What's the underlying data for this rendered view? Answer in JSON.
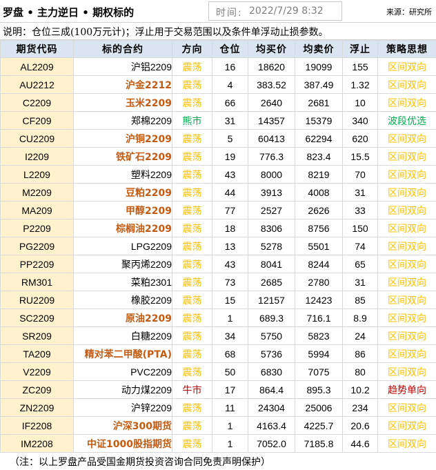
{
  "header": {
    "title": "罗盘 • 主力逆日 • 期权标的",
    "time_label": "时间:",
    "time_value": "2022/7/29 8:32",
    "source": "来源：研究所"
  },
  "note": "说明：仓位三成(100万元计)；浮止用于交易范围以及条件单浮动止损参数。",
  "columns": [
    "期货代码",
    "标的合约",
    "方向",
    "仓位",
    "均买价",
    "均卖价",
    "浮止",
    "策略思想"
  ],
  "rows": [
    {
      "code": "AL2209",
      "contract": "沪铝2209",
      "bold": false,
      "direction": "震荡",
      "dir_color": "yellow",
      "position": "16",
      "buy": "18620",
      "sell": "19099",
      "stop": "155",
      "strategy": "区间双向",
      "strat_color": "yellow"
    },
    {
      "code": "AU2212",
      "contract": "沪金2212",
      "bold": true,
      "direction": "震荡",
      "dir_color": "yellow",
      "position": "4",
      "buy": "383.52",
      "sell": "387.49",
      "stop": "1.32",
      "strategy": "区间双向",
      "strat_color": "yellow"
    },
    {
      "code": "C2209",
      "contract": "玉米2209",
      "bold": true,
      "direction": "震荡",
      "dir_color": "yellow",
      "position": "66",
      "buy": "2640",
      "sell": "2681",
      "stop": "10",
      "strategy": "区间双向",
      "strat_color": "yellow"
    },
    {
      "code": "CF209",
      "contract": "郑棉2209",
      "bold": false,
      "direction": "熊市",
      "dir_color": "green",
      "position": "31",
      "buy": "14357",
      "sell": "15379",
      "stop": "340",
      "strategy": "波段优选",
      "strat_color": "green"
    },
    {
      "code": "CU2209",
      "contract": "沪铜2209",
      "bold": true,
      "direction": "震荡",
      "dir_color": "yellow",
      "position": "5",
      "buy": "60413",
      "sell": "62294",
      "stop": "620",
      "strategy": "区间双向",
      "strat_color": "yellow"
    },
    {
      "code": "I2209",
      "contract": "铁矿石2209",
      "bold": true,
      "direction": "震荡",
      "dir_color": "yellow",
      "position": "19",
      "buy": "776.3",
      "sell": "823.4",
      "stop": "15.5",
      "strategy": "区间双向",
      "strat_color": "yellow"
    },
    {
      "code": "L2209",
      "contract": "塑料2209",
      "bold": false,
      "direction": "震荡",
      "dir_color": "yellow",
      "position": "43",
      "buy": "8000",
      "sell": "8219",
      "stop": "70",
      "strategy": "区间双向",
      "strat_color": "yellow"
    },
    {
      "code": "M2209",
      "contract": "豆粕2209",
      "bold": true,
      "direction": "震荡",
      "dir_color": "yellow",
      "position": "44",
      "buy": "3913",
      "sell": "4008",
      "stop": "31",
      "strategy": "区间双向",
      "strat_color": "yellow"
    },
    {
      "code": "MA209",
      "contract": "甲醇2209",
      "bold": true,
      "direction": "震荡",
      "dir_color": "yellow",
      "position": "77",
      "buy": "2527",
      "sell": "2626",
      "stop": "33",
      "strategy": "区间双向",
      "strat_color": "yellow"
    },
    {
      "code": "P2209",
      "contract": "棕榈油2209",
      "bold": true,
      "direction": "震荡",
      "dir_color": "yellow",
      "position": "18",
      "buy": "8306",
      "sell": "8756",
      "stop": "150",
      "strategy": "区间双向",
      "strat_color": "yellow"
    },
    {
      "code": "PG2209",
      "contract": "LPG2209",
      "bold": false,
      "direction": "震荡",
      "dir_color": "yellow",
      "position": "13",
      "buy": "5278",
      "sell": "5501",
      "stop": "74",
      "strategy": "区间双向",
      "strat_color": "yellow"
    },
    {
      "code": "PP2209",
      "contract": "聚丙烯2209",
      "bold": false,
      "direction": "震荡",
      "dir_color": "yellow",
      "position": "43",
      "buy": "8041",
      "sell": "8244",
      "stop": "65",
      "strategy": "区间双向",
      "strat_color": "yellow"
    },
    {
      "code": "RM301",
      "contract": "菜粕2301",
      "bold": false,
      "direction": "震荡",
      "dir_color": "yellow",
      "position": "73",
      "buy": "2685",
      "sell": "2780",
      "stop": "31",
      "strategy": "区间双向",
      "strat_color": "yellow"
    },
    {
      "code": "RU2209",
      "contract": "橡胶2209",
      "bold": false,
      "direction": "震荡",
      "dir_color": "yellow",
      "position": "15",
      "buy": "12157",
      "sell": "12423",
      "stop": "85",
      "strategy": "区间双向",
      "strat_color": "yellow"
    },
    {
      "code": "SC2209",
      "contract": "原油2209",
      "bold": true,
      "direction": "震荡",
      "dir_color": "yellow",
      "position": "1",
      "buy": "689.3",
      "sell": "716.1",
      "stop": "8.9",
      "strategy": "区间双向",
      "strat_color": "yellow"
    },
    {
      "code": "SR209",
      "contract": "白糖2209",
      "bold": false,
      "direction": "震荡",
      "dir_color": "yellow",
      "position": "34",
      "buy": "5750",
      "sell": "5823",
      "stop": "24",
      "strategy": "区间双向",
      "strat_color": "yellow"
    },
    {
      "code": "TA209",
      "contract": "精对苯二甲酸(PTA)",
      "bold": true,
      "direction": "震荡",
      "dir_color": "yellow",
      "position": "68",
      "buy": "5736",
      "sell": "5994",
      "stop": "86",
      "strategy": "区间双向",
      "strat_color": "yellow"
    },
    {
      "code": "V2209",
      "contract": "PVC2209",
      "bold": false,
      "direction": "震荡",
      "dir_color": "yellow",
      "position": "50",
      "buy": "6830",
      "sell": "7075",
      "stop": "80",
      "strategy": "区间双向",
      "strat_color": "yellow"
    },
    {
      "code": "ZC209",
      "contract": "动力煤2209",
      "bold": false,
      "direction": "牛市",
      "dir_color": "red",
      "position": "17",
      "buy": "864.4",
      "sell": "895.3",
      "stop": "10.2",
      "strategy": "趋势单向",
      "strat_color": "red"
    },
    {
      "code": "ZN2209",
      "contract": "沪锌2209",
      "bold": false,
      "direction": "震荡",
      "dir_color": "yellow",
      "position": "11",
      "buy": "24304",
      "sell": "25006",
      "stop": "234",
      "strategy": "区间双向",
      "strat_color": "yellow"
    },
    {
      "code": "IF2208",
      "contract": "沪深300期货",
      "bold": true,
      "direction": "震荡",
      "dir_color": "yellow",
      "position": "1",
      "buy": "4163.4",
      "sell": "4225.7",
      "stop": "20.6",
      "strategy": "区间双向",
      "strat_color": "yellow"
    },
    {
      "code": "IM2208",
      "contract": "中证1000股指期货",
      "bold": true,
      "direction": "震荡",
      "dir_color": "yellow",
      "position": "1",
      "buy": "7052.0",
      "sell": "7185.8",
      "stop": "44.6",
      "strategy": "区间双向",
      "strat_color": "yellow"
    }
  ],
  "footer": "（注：以上罗盘产品受国金期货投资咨询合同免责声明保护）",
  "colors": {
    "header_bg": "#dbe5f1",
    "code_bg": "#fff2cc",
    "bold_contract": "#c55a11",
    "yellow_text": "#ffc000",
    "green_text": "#00b050",
    "red_text": "#c00000"
  }
}
